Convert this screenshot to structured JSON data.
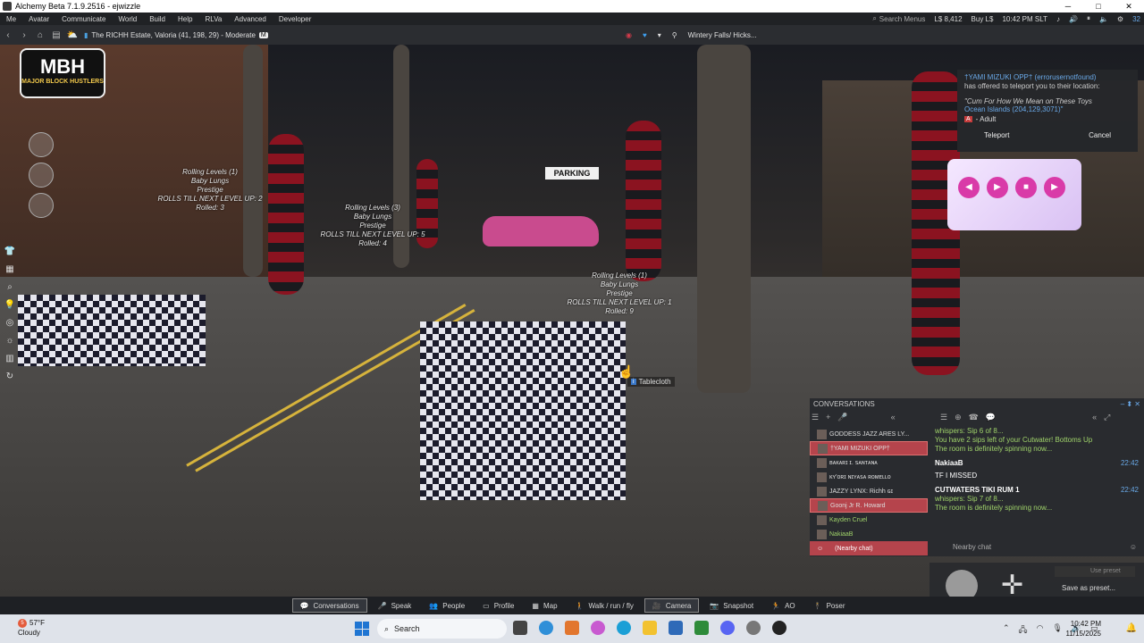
{
  "window": {
    "title": "Alchemy Beta 7.1.9.2516 - ejwizzle",
    "minimize": "─",
    "maximize": "□",
    "close": "✕"
  },
  "menu": {
    "items": [
      "Me",
      "Avatar",
      "Communicate",
      "World",
      "Build",
      "Help",
      "RLVa",
      "Advanced",
      "Developer"
    ],
    "search_placeholder": "Search Menus",
    "balance": "L$ 8,412",
    "buy": "Buy L$",
    "time": "10:42 PM SLT",
    "fps": "32"
  },
  "nav": {
    "location": "The RICHH Estate, Valoria (41, 198, 29) - Moderate",
    "maturity_badge": "M",
    "pick": "Wintery Falls/ Hicks..."
  },
  "scene": {
    "logo_main": "MBH",
    "logo_sub": "MAJOR BLOCK HUSTLERS",
    "parking_sign": "PARKING",
    "overhead_1": [
      "Rolling Levels (1)",
      "Baby Lungs",
      "Prestige",
      "ROLLS TILL NEXT LEVEL UP: 2",
      "Rolled: 3"
    ],
    "overhead_2": [
      "Rolling Levels (3)",
      "Baby Lungs",
      "Prestige",
      "ROLLS TILL NEXT LEVEL UP: 5",
      "Rolled: 4"
    ],
    "overhead_3": [
      "Rolling Levels (1)",
      "Baby Lungs",
      "Prestige",
      "ROLLS TILL NEXT LEVEL UP: 1",
      "Rolled: 9"
    ],
    "tooltip": "Tablecloth"
  },
  "teleport": {
    "from": "†YAMI MIZUKI OPP† (errorusernotfound)",
    "message": "has offered to teleport you to their location:",
    "quote": "\"Cum For How We Mean on These Toys",
    "destination": "Ocean Islands (204,129,3071)\"",
    "rating_badge": "A",
    "rating": "- Adult",
    "accept": "Teleport",
    "cancel": "Cancel"
  },
  "conversations": {
    "title": "CONVERSATIONS",
    "list": [
      {
        "name": "GODDESS JAZZ ARES LY...",
        "style": ""
      },
      {
        "name": "†YAMI MIZUKI OPP†",
        "style": "sel"
      },
      {
        "name": "ʙᴀᴋᴀʀɪ ɪ. ꜱᴀɴᴛᴀɴᴀ",
        "style": ""
      },
      {
        "name": "ᴋʏ'ᴏʀɪ ɴɪʏᴀꜱᴀ ʀᴏᴍᴇʟʟᴏ",
        "style": ""
      },
      {
        "name": "JAZZY LYNX: Richh ɢɪ",
        "style": ""
      },
      {
        "name": "Goonj Jr R. Howard",
        "style": "sel"
      },
      {
        "name": "Kayden Cruel",
        "style": "green"
      },
      {
        "name": "NakiaaB",
        "style": "green"
      },
      {
        "name": "(Nearby chat)",
        "style": "nearby"
      }
    ],
    "messages": {
      "m1": "whispers: Sip 6 of 8...",
      "m2": "You have 2 sips left of your Cutwater! Bottoms Up",
      "m3": "The room is definitely spinning now...",
      "n1_name": "NakiaaB",
      "n1_time": "22:42",
      "n1_text": "TF I MISSED",
      "n2_name": "CUTWATERS TIKI RUM 1",
      "n2_time": "22:42",
      "m4": "whispers: Sip 7 of 8...",
      "m5": "The room is definitely spinning now..."
    },
    "input_placeholder": "Nearby chat"
  },
  "movement": {
    "preset_placeholder": "Use preset",
    "save": "Save as preset..."
  },
  "toolbar": {
    "items": [
      {
        "label": "Conversations",
        "icon": "speech-bubble",
        "active": true
      },
      {
        "label": "Speak",
        "icon": "mic"
      },
      {
        "label": "People",
        "icon": "people"
      },
      {
        "label": "Profile",
        "icon": "id-card"
      },
      {
        "label": "Map",
        "icon": "map"
      },
      {
        "label": "Walk / run / fly",
        "icon": "walk"
      },
      {
        "label": "Camera",
        "icon": "camera",
        "active": true
      },
      {
        "label": "Snapshot",
        "icon": "snapshot"
      },
      {
        "label": "AO",
        "icon": "ao"
      },
      {
        "label": "Poser",
        "icon": "poser"
      }
    ]
  },
  "taskbar": {
    "temp": "57°F",
    "condition": "Cloudy",
    "search": "Search",
    "time": "10:42 PM",
    "date": "11/15/2025"
  },
  "colors": {
    "accent": "#b5444c",
    "link": "#6aa9e8",
    "green_text": "#9fd26a"
  }
}
